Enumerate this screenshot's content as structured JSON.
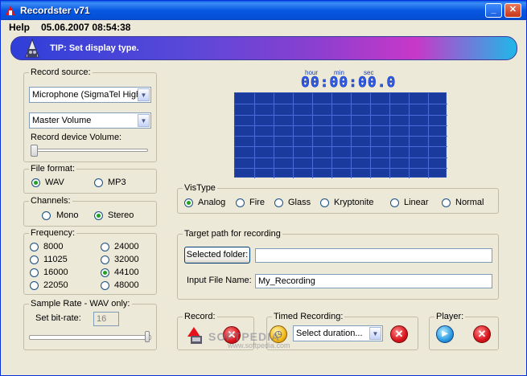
{
  "window": {
    "title": "Recordster v71",
    "minimize_glyph": "_",
    "close_glyph": "✕"
  },
  "menubar": {
    "help": "Help",
    "datetime": "05.06.2007 08:54:38"
  },
  "tip": {
    "text": "TIP: Set display type.",
    "icon": "speaker-tip-icon"
  },
  "record_source": {
    "legend": "Record source:",
    "source_value": "Microphone (SigmaTel High",
    "volume_value": "Master Volume",
    "device_volume_label": "Record device Volume:",
    "device_volume_level": 0
  },
  "file_format": {
    "legend": "File format:",
    "options": [
      "WAV",
      "MP3"
    ],
    "selected": "WAV"
  },
  "channels": {
    "legend": "Channels:",
    "options": [
      "Mono",
      "Stereo"
    ],
    "selected": "Stereo"
  },
  "frequency": {
    "legend": "Frequency:",
    "left": [
      "8000",
      "11025",
      "16000",
      "22050"
    ],
    "right": [
      "24000",
      "32000",
      "44100",
      "48000"
    ],
    "selected": "44100"
  },
  "sample_rate": {
    "legend": "Sample Rate - WAV only:",
    "bit_rate_label": "Set bit-rate:",
    "bit_rate_value": "16",
    "slider_level": 1
  },
  "timer": {
    "hour_label": "hour",
    "min_label": "min",
    "sec_label": "sec",
    "digits": "00:00:00.0"
  },
  "vistype": {
    "legend": "VisType",
    "options": [
      "Analog",
      "Fire",
      "Glass",
      "Kryptonite",
      "Linear",
      "Normal"
    ],
    "selected": "Analog"
  },
  "target": {
    "legend": "Target path for recording",
    "selected_folder_button": "Selected folder:",
    "folder_value": "",
    "input_file_label": "Input File Name:",
    "input_file_value": "My_Recording"
  },
  "record": {
    "legend": "Record:"
  },
  "timed": {
    "legend": "Timed Recording:",
    "select_value": "Select duration..."
  },
  "player": {
    "legend": "Player:"
  },
  "watermark": {
    "main": "SOFTPEDIA",
    "sub": "www.softpedia.com"
  },
  "colors": {
    "display_bg": "#1b3a9e",
    "grid_line": "#4a6ad8",
    "titlebar": "#0a5ee8"
  }
}
